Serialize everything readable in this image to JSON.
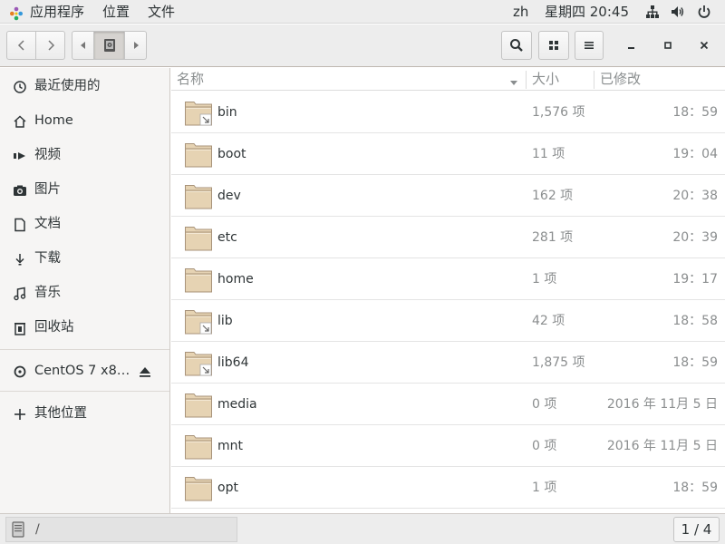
{
  "topbar": {
    "apps_label": "应用程序",
    "places_label": "位置",
    "files_label": "文件",
    "lang": "zh",
    "clock": "星期四 20:45"
  },
  "sidebar": {
    "items": [
      {
        "label": "最近使用的",
        "icon": "recent-icon"
      },
      {
        "label": "Home",
        "icon": "home-icon"
      },
      {
        "label": "视频",
        "icon": "video-icon"
      },
      {
        "label": "图片",
        "icon": "camera-icon"
      },
      {
        "label": "文档",
        "icon": "document-icon"
      },
      {
        "label": "下载",
        "icon": "download-icon"
      },
      {
        "label": "音乐",
        "icon": "music-icon"
      },
      {
        "label": "回收站",
        "icon": "trash-icon"
      }
    ],
    "device": {
      "label": "CentOS 7 x8…",
      "icon": "disc-icon"
    },
    "other": {
      "label": "其他位置",
      "icon": "plus-icon"
    }
  },
  "columns": {
    "name": "名称",
    "size": "大小",
    "modified": "已修改"
  },
  "files": [
    {
      "name": "bin",
      "size": "1,576 项",
      "modified": "18：59",
      "link": true
    },
    {
      "name": "boot",
      "size": "11 项",
      "modified": "19：04",
      "link": false
    },
    {
      "name": "dev",
      "size": "162 项",
      "modified": "20：38",
      "link": false
    },
    {
      "name": "etc",
      "size": "281 项",
      "modified": "20：39",
      "link": false
    },
    {
      "name": "home",
      "size": "1 项",
      "modified": "19：17",
      "link": false
    },
    {
      "name": "lib",
      "size": "42 项",
      "modified": "18：58",
      "link": true
    },
    {
      "name": "lib64",
      "size": "1,875 项",
      "modified": "18：59",
      "link": true
    },
    {
      "name": "media",
      "size": "0 项",
      "modified": "2016 年 11月  5 日",
      "link": false
    },
    {
      "name": "mnt",
      "size": "0 项",
      "modified": "2016 年 11月  5 日",
      "link": false
    },
    {
      "name": "opt",
      "size": "1 项",
      "modified": "18：59",
      "link": false
    }
  ],
  "status": {
    "path": "/",
    "page": "1 / 4"
  },
  "colors": {
    "folder_body": "#e6d3b3",
    "folder_edge": "#a8937a",
    "accent": "#2e3436"
  }
}
